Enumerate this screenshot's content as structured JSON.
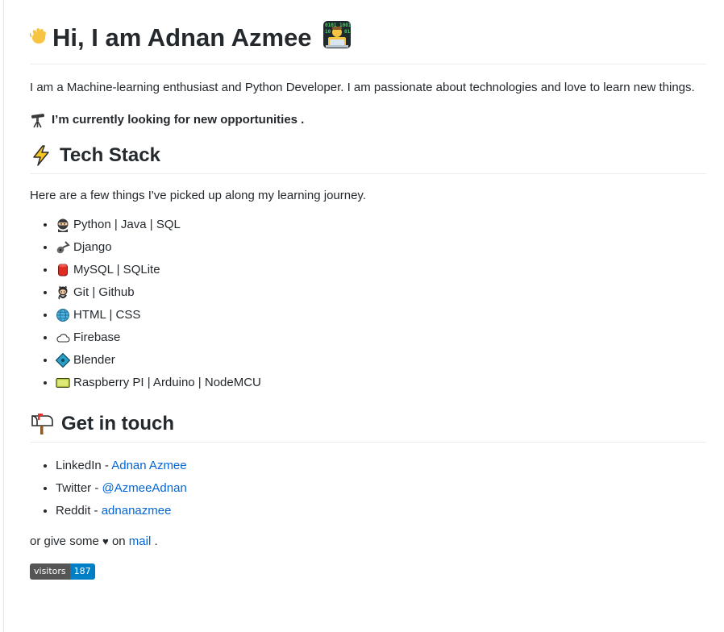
{
  "header": {
    "title": "Hi, I am Adnan Azmee",
    "wave_icon": "waving-hand-icon",
    "title_icon": "technologist-icon"
  },
  "intro": "I am a Machine-learning enthusiast and Python Developer. I am passionate about technologies and love to learn new things.",
  "status": {
    "icon": "telescope-icon",
    "text": "I’m currently looking for new opportunities ."
  },
  "tech_stack": {
    "heading": "Tech Stack",
    "icon": "lightning-icon",
    "lead": "Here are a few things I've picked up along my learning journey.",
    "items": [
      {
        "icon": "ninja-icon",
        "label": "Python | Java | SQL"
      },
      {
        "icon": "guitar-icon",
        "label": "Django"
      },
      {
        "icon": "database-icon",
        "label": "MySQL | SQLite"
      },
      {
        "icon": "octocat-icon",
        "label": "Git | Github"
      },
      {
        "icon": "globe-icon",
        "label": "HTML | CSS"
      },
      {
        "icon": "cloud-icon",
        "label": "Firebase"
      },
      {
        "icon": "blender-icon",
        "label": "Blender"
      },
      {
        "icon": "circuit-board-icon",
        "label": "Raspberry PI | Arduino | NodeMCU"
      }
    ]
  },
  "contact": {
    "heading": "Get in touch",
    "icon": "mailbox-icon",
    "items": [
      {
        "prefix": "LinkedIn - ",
        "link": "Adnan Azmee"
      },
      {
        "prefix": "Twitter - ",
        "link": "@AzmeeAdnan"
      },
      {
        "prefix": "Reddit - ",
        "link": "adnanazmee"
      }
    ],
    "mail_prefix": "or give some",
    "heart": "♥",
    "mail_mid": "on",
    "mail_link": "mail",
    "mail_suffix": "."
  },
  "badge": {
    "label": "visitors",
    "count": "187"
  },
  "colors": {
    "link": "#0366d6",
    "badge_label": "#555555",
    "badge_count": "#007ec6"
  }
}
